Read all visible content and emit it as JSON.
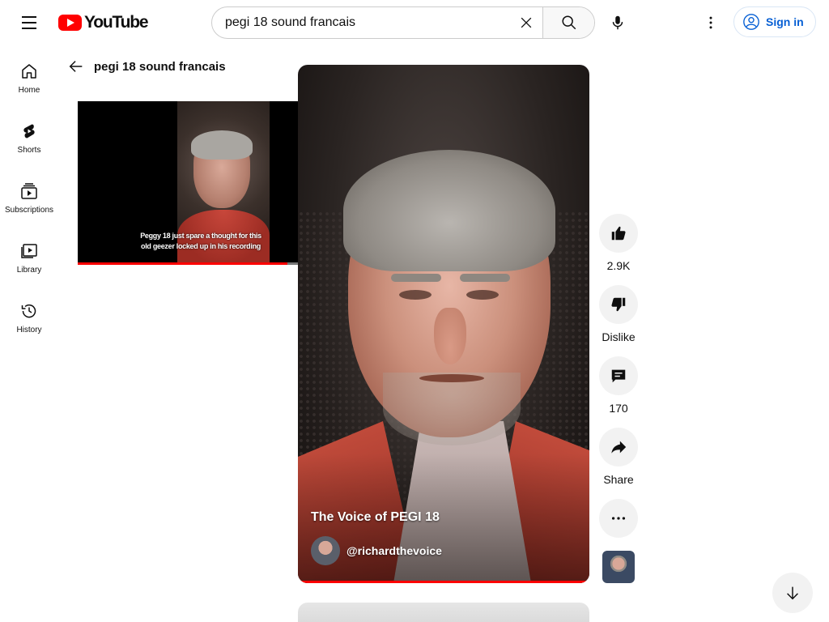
{
  "header": {
    "logo_text": "YouTube",
    "search_value": "pegi 18 sound francais",
    "search_placeholder": "Search",
    "signin_label": "Sign in"
  },
  "sidebar": {
    "items": [
      {
        "label": "Home",
        "icon": "home-icon"
      },
      {
        "label": "Shorts",
        "icon": "shorts-icon"
      },
      {
        "label": "Subscriptions",
        "icon": "subscriptions-icon"
      },
      {
        "label": "Library",
        "icon": "library-icon"
      },
      {
        "label": "History",
        "icon": "history-icon"
      }
    ]
  },
  "query_title": "pegi 18 sound francais",
  "mini_player": {
    "caption_line1": "Peggy 18 just spare a thought for this",
    "caption_line2": "old geezer locked up in his recording",
    "progress": 0.72
  },
  "short": {
    "title": "The Voice of PEGI 18",
    "channel_handle": "@richardthevoice",
    "progress": 1.0
  },
  "actions": {
    "like_count": "2.9K",
    "dislike_label": "Dislike",
    "comment_count": "170",
    "share_label": "Share"
  },
  "colors": {
    "brand_red": "#ff0000",
    "link_blue": "#065fd4"
  }
}
